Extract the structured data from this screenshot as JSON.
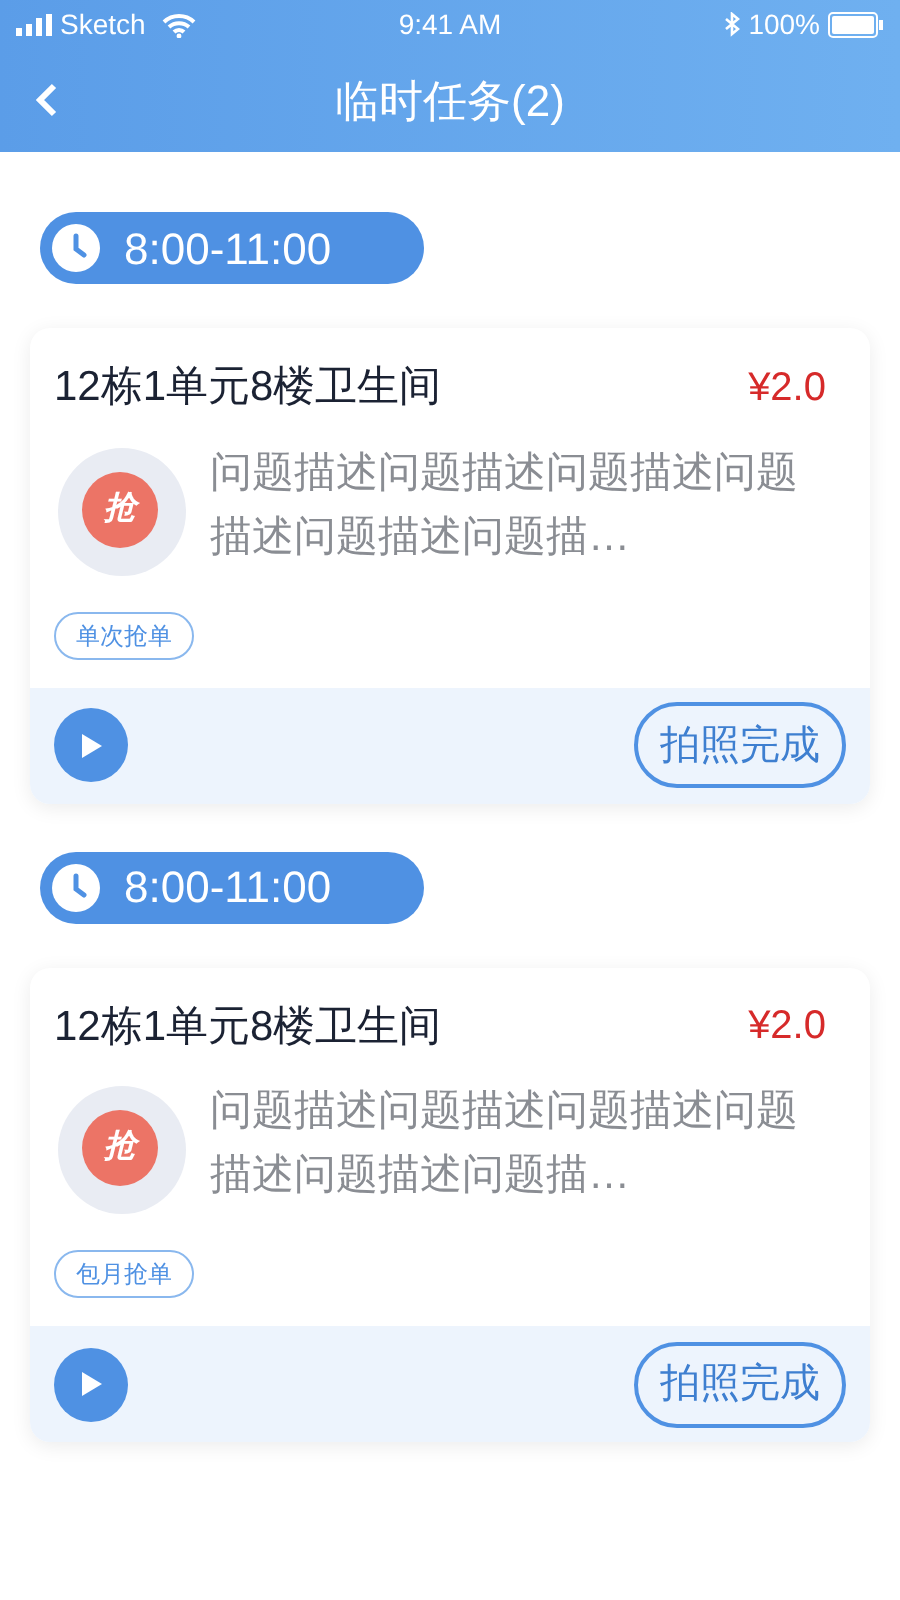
{
  "status_bar": {
    "carrier": "Sketch",
    "time": "9:41 AM",
    "battery": "100%"
  },
  "nav": {
    "title": "临时任务(2)"
  },
  "groups": [
    {
      "time_range": "8:00-11:00",
      "task": {
        "location": "12栋1单元8楼卫生间",
        "price": "¥2.0",
        "icon_char": "抢",
        "description": "问题描述问题描述问题描述问题描述问题描述问题描…",
        "tag": "单次抢单",
        "action": "拍照完成"
      }
    },
    {
      "time_range": "8:00-11:00",
      "task": {
        "location": "12栋1单元8楼卫生间",
        "price": "¥2.0",
        "icon_char": "抢",
        "description": "问题描述问题描述问题描述问题描述问题描述问题描…",
        "tag": "包月抢单",
        "action": "拍照完成"
      }
    }
  ]
}
